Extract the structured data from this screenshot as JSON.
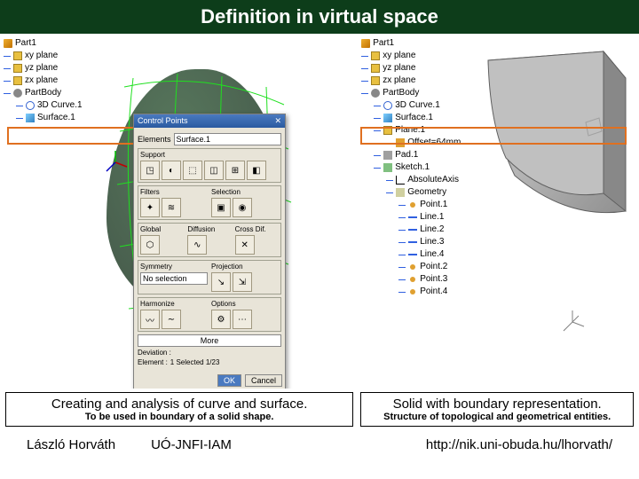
{
  "title": "Definition in virtual space",
  "left_tree": {
    "root": "Part1",
    "items": [
      {
        "label": "xy plane",
        "icon": "ic-plane"
      },
      {
        "label": "yz plane",
        "icon": "ic-plane"
      },
      {
        "label": "zx plane",
        "icon": "ic-plane"
      },
      {
        "label": "PartBody",
        "icon": "ic-body"
      },
      {
        "label": "3D Curve.1",
        "icon": "ic-curve",
        "indent": 1
      },
      {
        "label": "Surface.1",
        "icon": "ic-surf",
        "indent": 1,
        "highlight": true
      }
    ]
  },
  "right_tree": {
    "root": "Part1",
    "items": [
      {
        "label": "xy plane",
        "icon": "ic-plane"
      },
      {
        "label": "yz plane",
        "icon": "ic-plane"
      },
      {
        "label": "zx plane",
        "icon": "ic-plane"
      },
      {
        "label": "PartBody",
        "icon": "ic-body"
      },
      {
        "label": "3D Curve.1",
        "icon": "ic-curve",
        "indent": 1
      },
      {
        "label": "Surface.1",
        "icon": "ic-surf",
        "indent": 1,
        "highlight": true
      },
      {
        "label": "Plane.1",
        "icon": "ic-plane",
        "indent": 1
      },
      {
        "label": "Offset=64mm",
        "icon": "ic-offset",
        "indent": 2
      },
      {
        "label": "Pad.1",
        "icon": "ic-pad",
        "indent": 1
      },
      {
        "label": "Sketch.1",
        "icon": "ic-sketch",
        "indent": 1
      },
      {
        "label": "AbsoluteAxis",
        "icon": "ic-axis",
        "indent": 2
      },
      {
        "label": "Geometry",
        "icon": "ic-geom",
        "indent": 2
      },
      {
        "label": "Point.1",
        "icon": "ic-point",
        "indent": 3
      },
      {
        "label": "Line.1",
        "icon": "ic-line",
        "indent": 3
      },
      {
        "label": "Line.2",
        "icon": "ic-line",
        "indent": 3
      },
      {
        "label": "Line.3",
        "icon": "ic-line",
        "indent": 3
      },
      {
        "label": "Line.4",
        "icon": "ic-line",
        "indent": 3
      },
      {
        "label": "Point.2",
        "icon": "ic-point",
        "indent": 3
      },
      {
        "label": "Point.3",
        "icon": "ic-point",
        "indent": 3
      },
      {
        "label": "Point.4",
        "icon": "ic-point",
        "indent": 3
      }
    ]
  },
  "dialog": {
    "title": "Control Points",
    "elements_label": "Elements",
    "elements_value": "Surface.1",
    "sections": {
      "support_label": "Support",
      "filters_label": "Filters",
      "selection_label": "Selection",
      "diffusion_label": "Diffusion",
      "global_label": "Global",
      "cross_label": "Cross Dif.",
      "symmetry_label": "Symmetry",
      "projection_label": "Projection",
      "no_selection": "No selection",
      "harmonize_label": "Harmonize",
      "options_label": "Options",
      "more_label": "More",
      "deviation_label": "Deviation :",
      "element_sel_label": "Element :",
      "element_sel_value": "1 Selected 1/23"
    },
    "buttons": {
      "ok": "OK",
      "cancel": "Cancel"
    }
  },
  "captions": {
    "left_title": "Creating and analysis of curve and surface.",
    "left_sub": "To be used in boundary of a solid shape.",
    "right_title": "Solid with boundary representation.",
    "right_sub": "Structure of topological and geometrical entities."
  },
  "footer": {
    "author": "László Horváth",
    "org": "UÓ-JNFI-IAM",
    "url": "http://nik.uni-obuda.hu/lhorvath/"
  }
}
